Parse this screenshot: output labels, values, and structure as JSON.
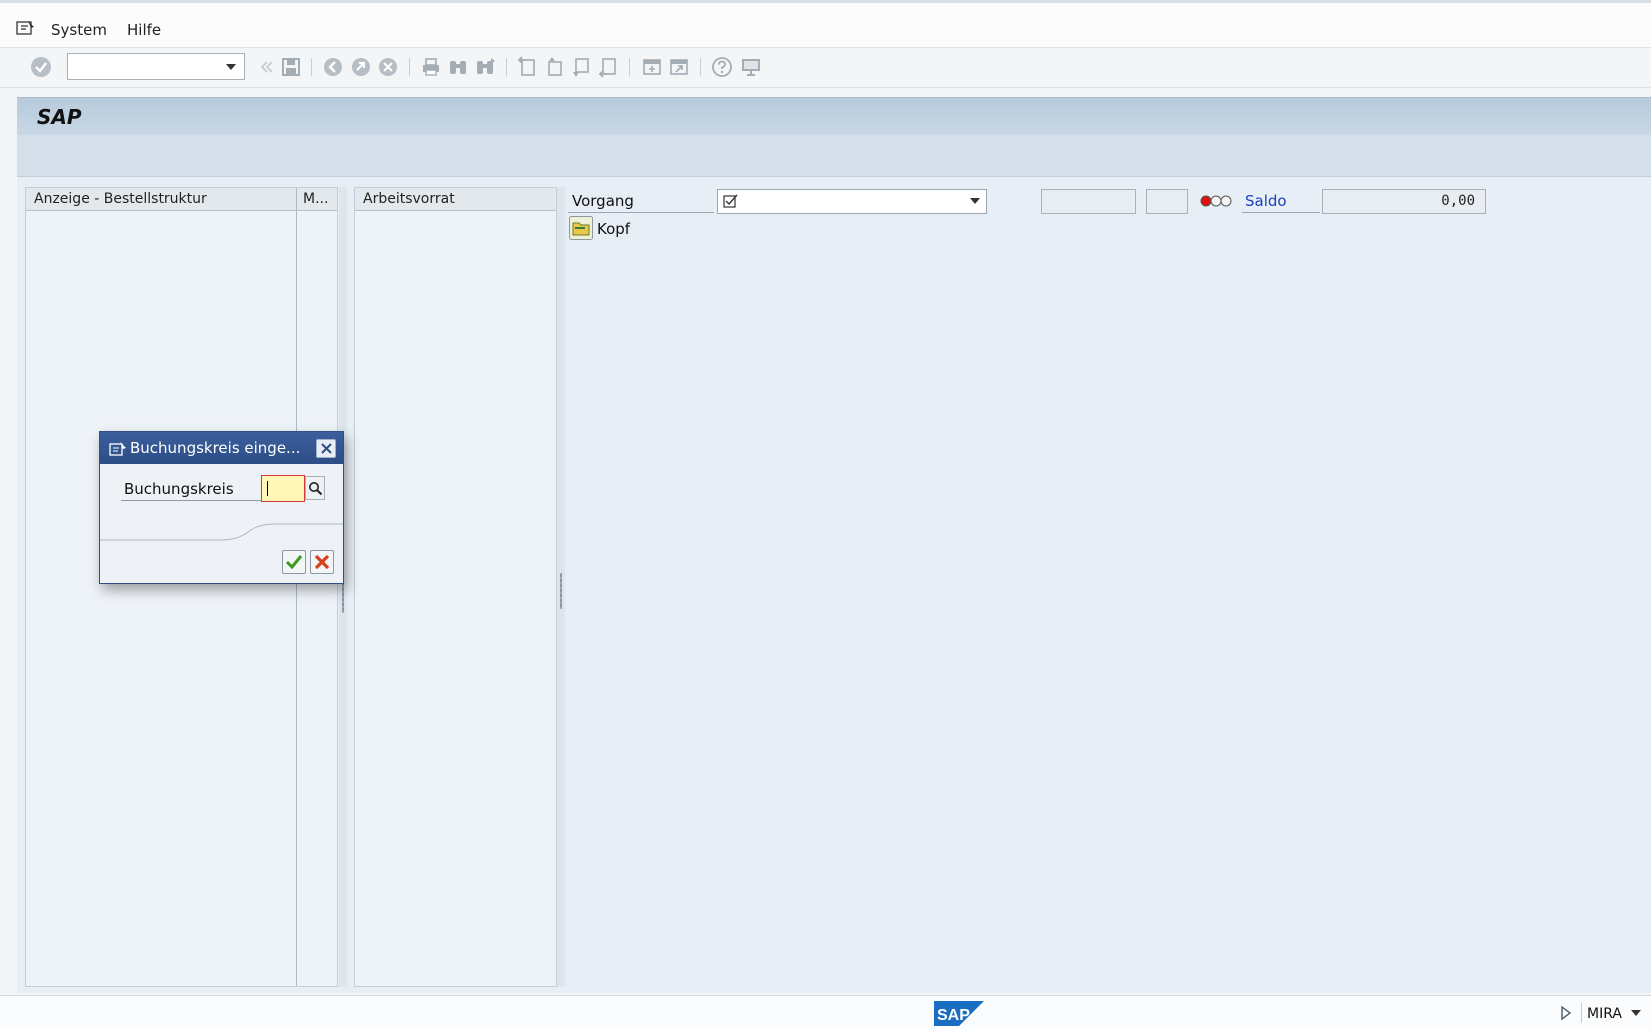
{
  "menu": {
    "items": [
      {
        "label": "System"
      },
      {
        "label": "Hilfe"
      }
    ]
  },
  "toolbar": {
    "command_field_value": ""
  },
  "title": "SAP",
  "panels": {
    "structure": {
      "header": "Anzeige - Bestellstruktur",
      "col2_header": "M..."
    },
    "worklist": {
      "header": "Arbeitsvorrat"
    }
  },
  "detail": {
    "vorgang_label": "Vorgang",
    "vorgang_value": "",
    "saldo_label": "Saldo",
    "saldo_value": "0,00",
    "kopf_label": "Kopf"
  },
  "dialog": {
    "title": "Buchungskreis einge...",
    "field_label": "Buchungskreis",
    "field_value": ""
  },
  "status": {
    "system": "MIRA"
  },
  "colors": {
    "title_gradient": "#b7cbdc",
    "dialog_header": "#2f4f86",
    "link": "#1a3fbf",
    "required_border": "#d03a3a",
    "input_highlight": "#fff6b8",
    "traffic_red": "#e01010"
  }
}
